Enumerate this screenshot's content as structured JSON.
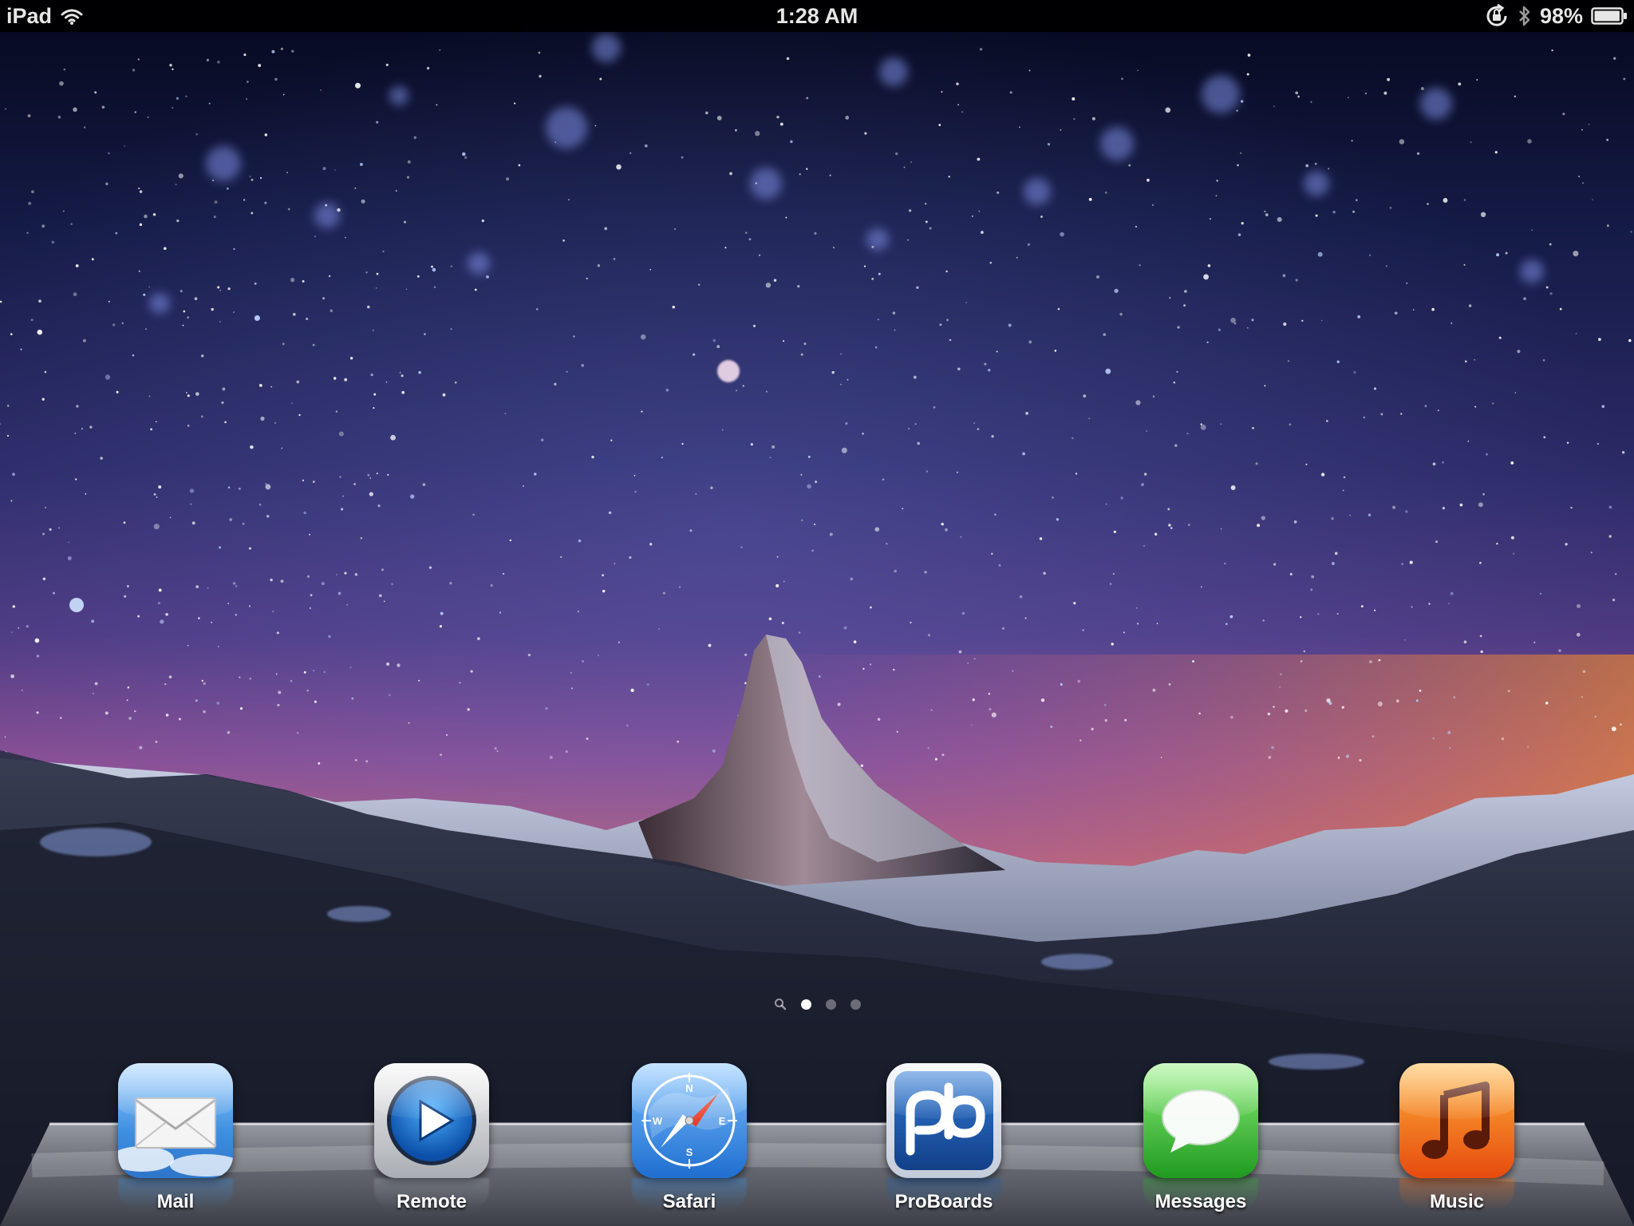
{
  "status_bar": {
    "device": "iPad",
    "time": "1:28 AM",
    "battery": "98%",
    "battery_level": 0.98,
    "icons": [
      "wifi-icon",
      "rotation-lock-icon",
      "bluetooth-icon",
      "battery-icon"
    ]
  },
  "wallpaper": {
    "description_icon": "mountain-starry-night-wallpaper",
    "colors": {
      "sky_top": "#0a0f2c",
      "sky_mid": "#3b2d6e",
      "horizon_pink": "#a45a9a",
      "horizon_orange": "#e07a35",
      "snow": "#cdd3e6"
    }
  },
  "page_indicator": {
    "pages": 3,
    "current": 1,
    "spotlight_icon": "search-icon"
  },
  "dock": {
    "apps": [
      {
        "label": "Mail",
        "icon": "mail-icon",
        "color": "#3a8bdc"
      },
      {
        "label": "Remote",
        "icon": "remote-icon",
        "color": "#1c6fc9"
      },
      {
        "label": "Safari",
        "icon": "safari-icon",
        "color": "#3b8ee8"
      },
      {
        "label": "ProBoards",
        "icon": "proboards-icon",
        "color": "#1e5fae"
      },
      {
        "label": "Messages",
        "icon": "messages-icon",
        "color": "#2fb22f"
      },
      {
        "label": "Music",
        "icon": "music-icon",
        "color": "#f06a12"
      }
    ]
  }
}
